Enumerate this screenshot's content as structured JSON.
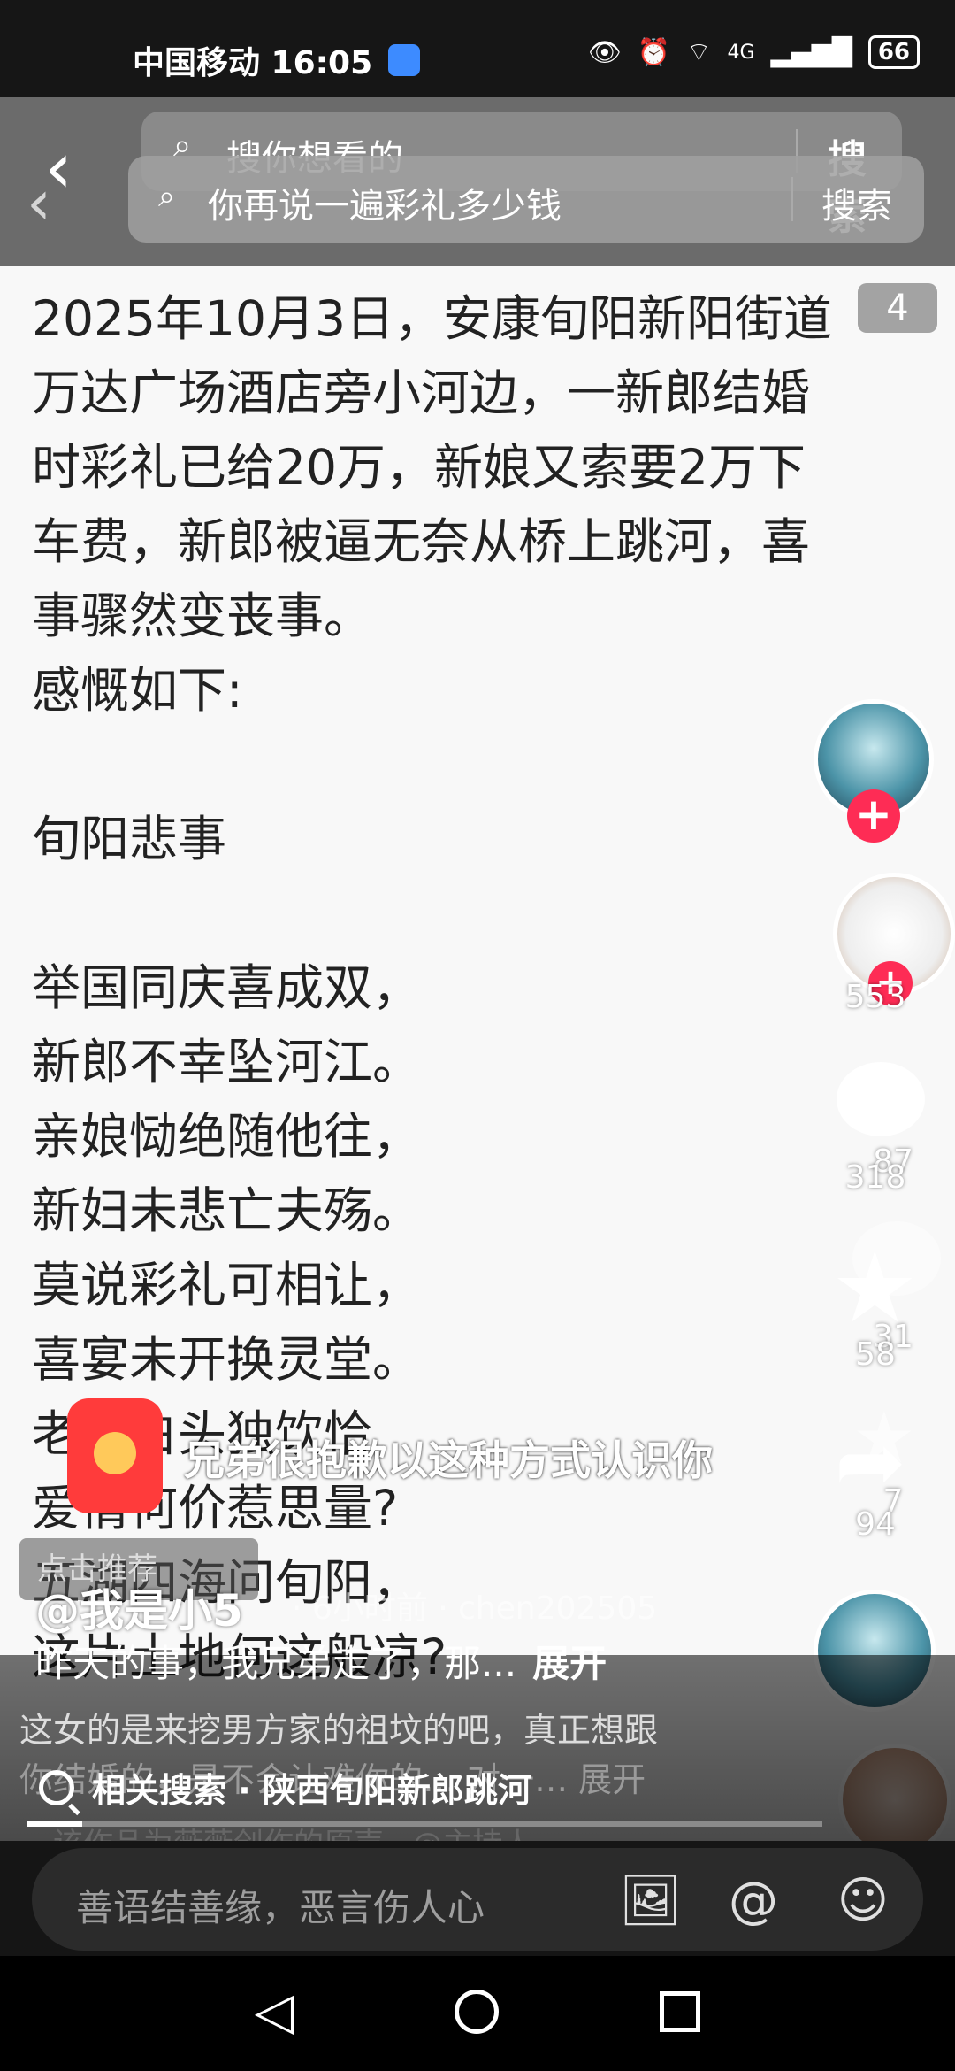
{
  "status_bar": {
    "carrier_time": "中国移动 16:05",
    "network": "4G",
    "battery": "66"
  },
  "header": {
    "search_placeholder": "搜你想看的",
    "search_button": "搜索",
    "search_placeholder_2": "你再说一遍彩礼多少钱",
    "search_button_2": "搜索"
  },
  "post": {
    "page_flag": "4",
    "lines": [
      "2025年10月3日，安康旬阳新阳街道",
      "万达广场酒店旁小河边，一新郎结婚",
      "时彩礼已给20万，新娘又索要2万下",
      "车费，新郎被逼无奈从桥上跳河，喜",
      "事骤然变丧事。",
      "感慨如下:",
      "",
      "旬阳悲事",
      "",
      "举国同庆喜成双，",
      "新郎不幸坠河江。",
      "亲娘恸绝随他往，",
      "新妇未悲亡夫殇。",
      "莫说彩礼可相让，",
      "喜宴未开换灵堂。",
      "老父白头独饮恰",
      "爱情何价惹思量?",
      "五湖四海问旬阳，",
      "这片土地何这般凉?"
    ]
  },
  "rail": {
    "likes": "553",
    "comments": "318",
    "comments_ghost": "87",
    "favorites": "58",
    "favorites_ghost": "31",
    "shares": "94",
    "shares_ghost": "7"
  },
  "overlay": {
    "caption": "兄弟很抱歉以这种方式认识你",
    "recommend_tag": "点击推荐",
    "author": "@我是小5",
    "time_ghost": "· 6小时前 · chen202505",
    "description": "昨天的事，我兄弟走了，那...",
    "expand": "展开",
    "video_progress": 0.07,
    "comment_preview_1": "这女的是来挖男方家的祖坟的吧，真正想跟",
    "comment_preview_2": "你结婚的，是不会让难你的… 对一… 展开",
    "related_search": "相关搜索 · 陕西旬阳新郎跳河",
    "comment_preview_3": "该作品为薇薇创作的原声 · @主持人"
  },
  "input_bar": {
    "placeholder": "善语结善缘，恶言伤人心"
  }
}
